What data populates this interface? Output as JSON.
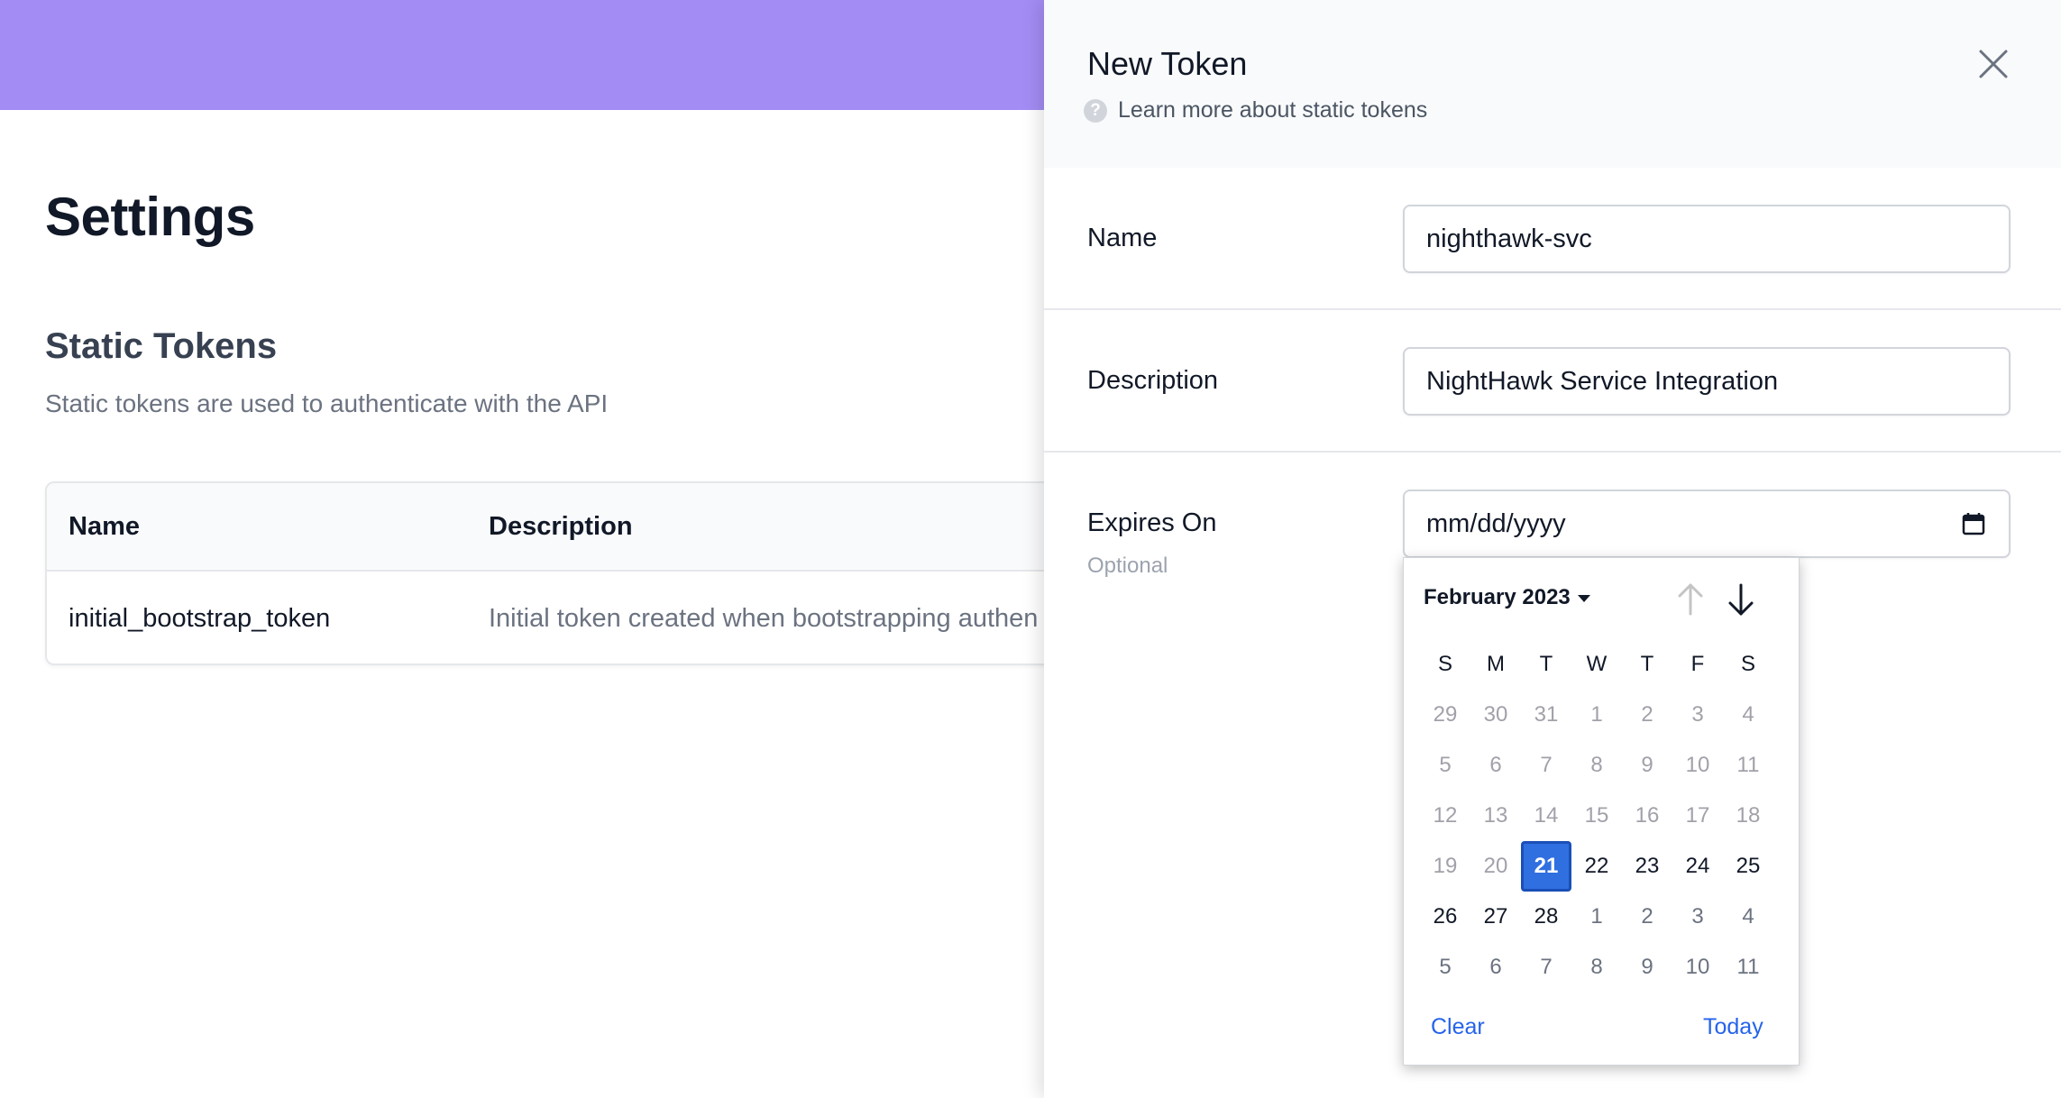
{
  "page": {
    "title": "Settings",
    "section_title": "Static Tokens",
    "section_subtitle": "Static tokens are used to authenticate with the API",
    "accent_color": "#a38cf4"
  },
  "table": {
    "headers": [
      "Name",
      "Description"
    ],
    "rows": [
      {
        "name": "initial_bootstrap_token",
        "description": "Initial token created when bootstrapping authen"
      }
    ]
  },
  "drawer": {
    "title": "New Token",
    "help_text": "Learn more about static tokens",
    "help_icon": "question-circle-icon",
    "close_icon": "close-icon",
    "fields": {
      "name": {
        "label": "Name",
        "value": "nighthawk-svc"
      },
      "description": {
        "label": "Description",
        "value": "NightHawk Service Integration"
      },
      "expires": {
        "label": "Expires On",
        "hint": "Optional",
        "placeholder": "mm/dd/yyyy"
      }
    }
  },
  "calendar": {
    "month_label": "February 2023",
    "weekdays": [
      "S",
      "M",
      "T",
      "W",
      "T",
      "F",
      "S"
    ],
    "days": [
      {
        "d": "29",
        "s": "dim"
      },
      {
        "d": "30",
        "s": "dim"
      },
      {
        "d": "31",
        "s": "dim"
      },
      {
        "d": "1",
        "s": "dim"
      },
      {
        "d": "2",
        "s": "dim"
      },
      {
        "d": "3",
        "s": "dim"
      },
      {
        "d": "4",
        "s": "dim"
      },
      {
        "d": "5",
        "s": "dim"
      },
      {
        "d": "6",
        "s": "dim"
      },
      {
        "d": "7",
        "s": "dim"
      },
      {
        "d": "8",
        "s": "dim"
      },
      {
        "d": "9",
        "s": "dim"
      },
      {
        "d": "10",
        "s": "dim"
      },
      {
        "d": "11",
        "s": "dim"
      },
      {
        "d": "12",
        "s": "dim"
      },
      {
        "d": "13",
        "s": "dim"
      },
      {
        "d": "14",
        "s": "dim"
      },
      {
        "d": "15",
        "s": "dim"
      },
      {
        "d": "16",
        "s": "dim"
      },
      {
        "d": "17",
        "s": "dim"
      },
      {
        "d": "18",
        "s": "dim"
      },
      {
        "d": "19",
        "s": "dim"
      },
      {
        "d": "20",
        "s": "dim"
      },
      {
        "d": "21",
        "s": "sel"
      },
      {
        "d": "22",
        "s": "cur"
      },
      {
        "d": "23",
        "s": "cur"
      },
      {
        "d": "24",
        "s": "cur"
      },
      {
        "d": "25",
        "s": "cur"
      },
      {
        "d": "26",
        "s": "cur"
      },
      {
        "d": "27",
        "s": "cur"
      },
      {
        "d": "28",
        "s": "cur"
      },
      {
        "d": "1",
        "s": "next"
      },
      {
        "d": "2",
        "s": "next"
      },
      {
        "d": "3",
        "s": "next"
      },
      {
        "d": "4",
        "s": "next"
      },
      {
        "d": "5",
        "s": "next"
      },
      {
        "d": "6",
        "s": "next"
      },
      {
        "d": "7",
        "s": "next"
      },
      {
        "d": "8",
        "s": "next"
      },
      {
        "d": "9",
        "s": "next"
      },
      {
        "d": "10",
        "s": "next"
      },
      {
        "d": "11",
        "s": "next"
      }
    ],
    "clear_label": "Clear",
    "today_label": "Today",
    "selected_color": "#2f6fe0"
  }
}
